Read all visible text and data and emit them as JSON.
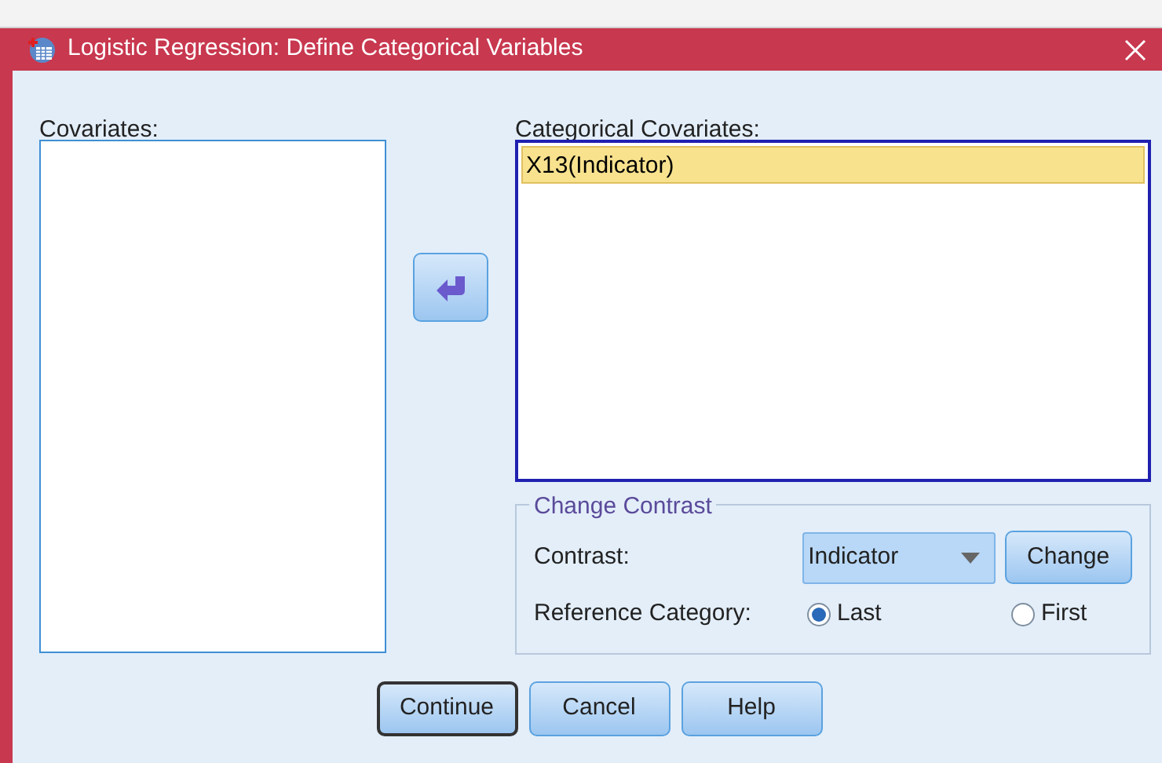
{
  "window": {
    "title": "Logistic Regression: Define Categorical Variables"
  },
  "covariates": {
    "label": "Covariates:"
  },
  "categorical_covariates": {
    "label": "Categorical Covariates:",
    "items": [
      {
        "text": "X13(Indicator)",
        "selected": true
      }
    ]
  },
  "change_contrast": {
    "title": "Change Contrast",
    "contrast_label": "Contrast:",
    "contrast_value": "Indicator",
    "change_button": "Change",
    "reference_label": "Reference Category:",
    "options": [
      {
        "label": "Last",
        "selected": true
      },
      {
        "label": "First",
        "selected": false
      }
    ]
  },
  "buttons": [
    {
      "label": "Continue",
      "focused": true
    },
    {
      "label": "Cancel",
      "focused": false
    },
    {
      "label": "Help",
      "focused": false
    }
  ]
}
